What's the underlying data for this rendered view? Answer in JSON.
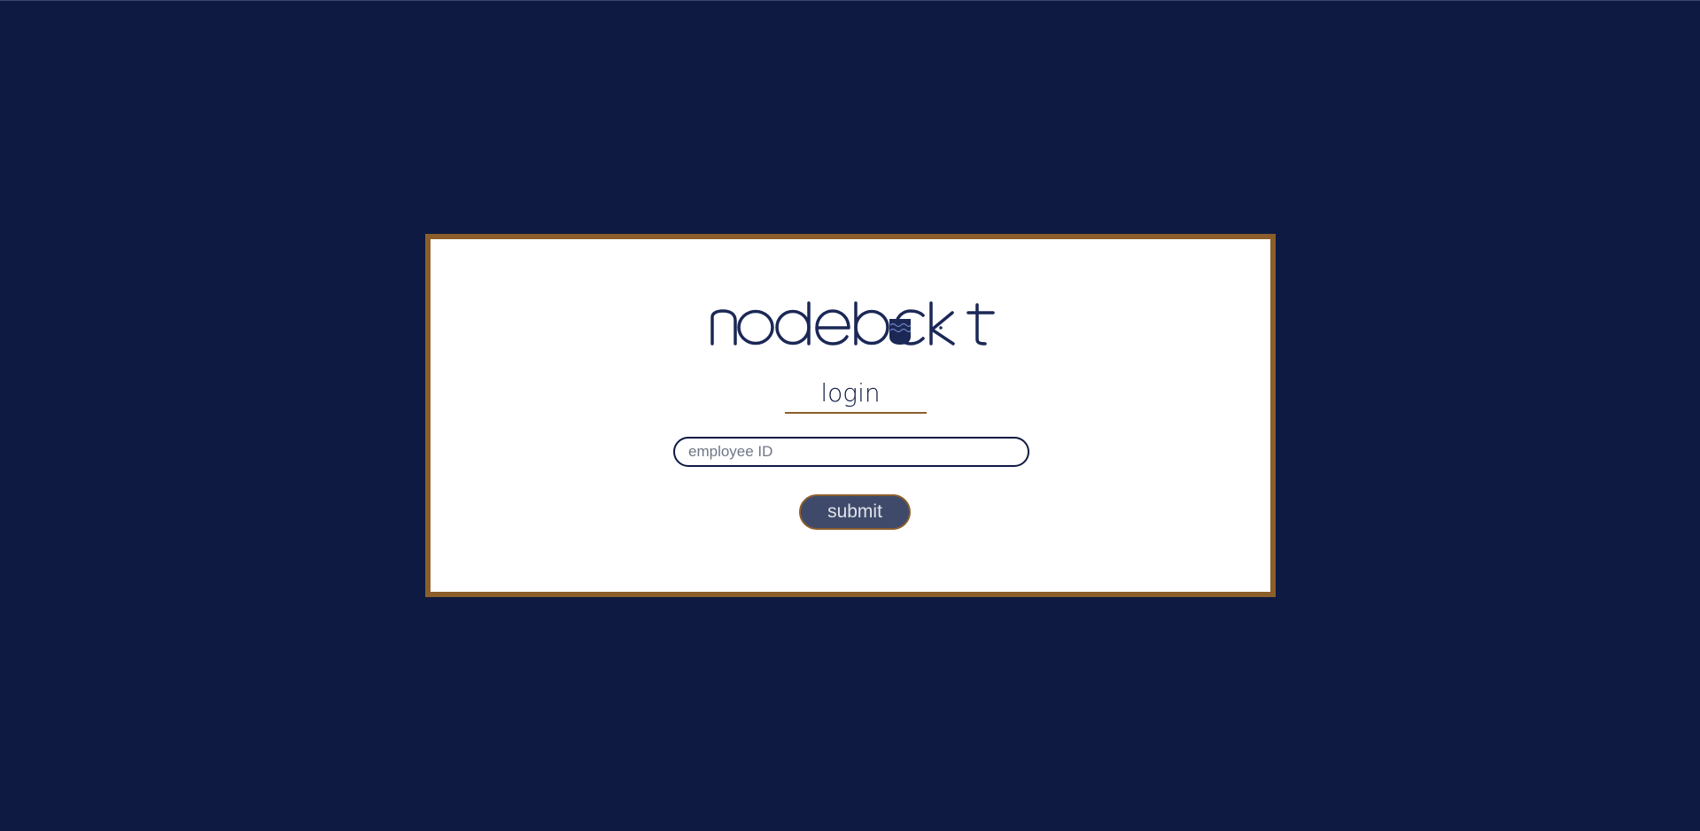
{
  "brand": {
    "logo_text": "nodebucket",
    "logo_color": "#1b2856"
  },
  "login": {
    "heading": "login",
    "employee_id_placeholder": "employee ID",
    "employee_id_value": "",
    "submit_label": "submit"
  },
  "colors": {
    "background": "#0e1a41",
    "card": "#ffffff",
    "card_border": "#8b5e2b",
    "accent": "#8b5e2b",
    "button": "#3f4a6b",
    "button_text": "#e0e3ea"
  }
}
